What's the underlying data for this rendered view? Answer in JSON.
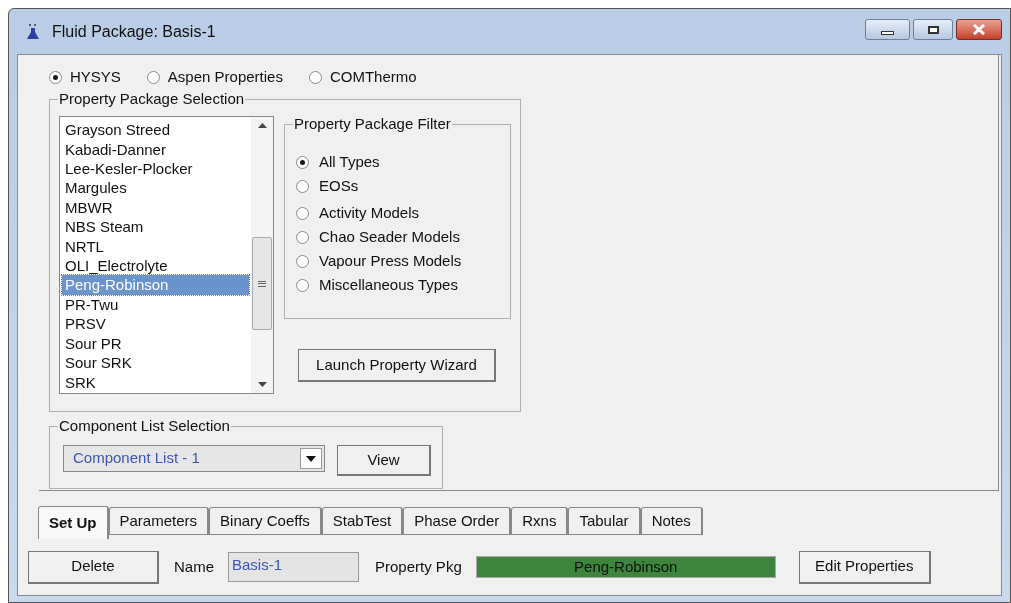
{
  "window": {
    "title": "Fluid Package: Basis-1"
  },
  "sources": [
    {
      "label": "HYSYS",
      "selected": true
    },
    {
      "label": "Aspen Properties",
      "selected": false
    },
    {
      "label": "COMThermo",
      "selected": false
    }
  ],
  "property_package_selection": {
    "title": "Property Package Selection",
    "items": [
      {
        "label": "Grayson Streed",
        "selected": false
      },
      {
        "label": "Kabadi-Danner",
        "selected": false
      },
      {
        "label": "Lee-Kesler-Plocker",
        "selected": false
      },
      {
        "label": "Margules",
        "selected": false
      },
      {
        "label": "MBWR",
        "selected": false
      },
      {
        "label": "NBS Steam",
        "selected": false
      },
      {
        "label": "NRTL",
        "selected": false
      },
      {
        "label": "OLI_Electrolyte",
        "selected": false
      },
      {
        "label": "Peng-Robinson",
        "selected": true
      },
      {
        "label": "PR-Twu",
        "selected": false
      },
      {
        "label": "PRSV",
        "selected": false
      },
      {
        "label": "Sour PR",
        "selected": false
      },
      {
        "label": "Sour SRK",
        "selected": false
      },
      {
        "label": "SRK",
        "selected": false
      }
    ]
  },
  "filter": {
    "title": "Property Package Filter",
    "options": [
      {
        "label": "All Types",
        "selected": true
      },
      {
        "label": "EOSs",
        "selected": false
      },
      {
        "label": "Activity Models",
        "selected": false
      },
      {
        "label": "Chao Seader Models",
        "selected": false
      },
      {
        "label": "Vapour Press Models",
        "selected": false
      },
      {
        "label": "Miscellaneous Types",
        "selected": false
      }
    ]
  },
  "wizard_button": "Launch Property Wizard",
  "component_list": {
    "title": "Component List Selection",
    "value": "Component List - 1",
    "view_button": "View"
  },
  "tabs": [
    {
      "label": "Set Up",
      "selected": true
    },
    {
      "label": "Parameters",
      "selected": false
    },
    {
      "label": "Binary Coeffs",
      "selected": false
    },
    {
      "label": "StabTest",
      "selected": false
    },
    {
      "label": "Phase Order",
      "selected": false
    },
    {
      "label": "Rxns",
      "selected": false
    },
    {
      "label": "Tabular",
      "selected": false
    },
    {
      "label": "Notes",
      "selected": false
    }
  ],
  "footer": {
    "delete_button": "Delete",
    "name_label": "Name",
    "name_value": "Basis-1",
    "pkg_label": "Property Pkg",
    "pkg_value": "Peng-Robinson",
    "edit_button": "Edit Properties"
  }
}
